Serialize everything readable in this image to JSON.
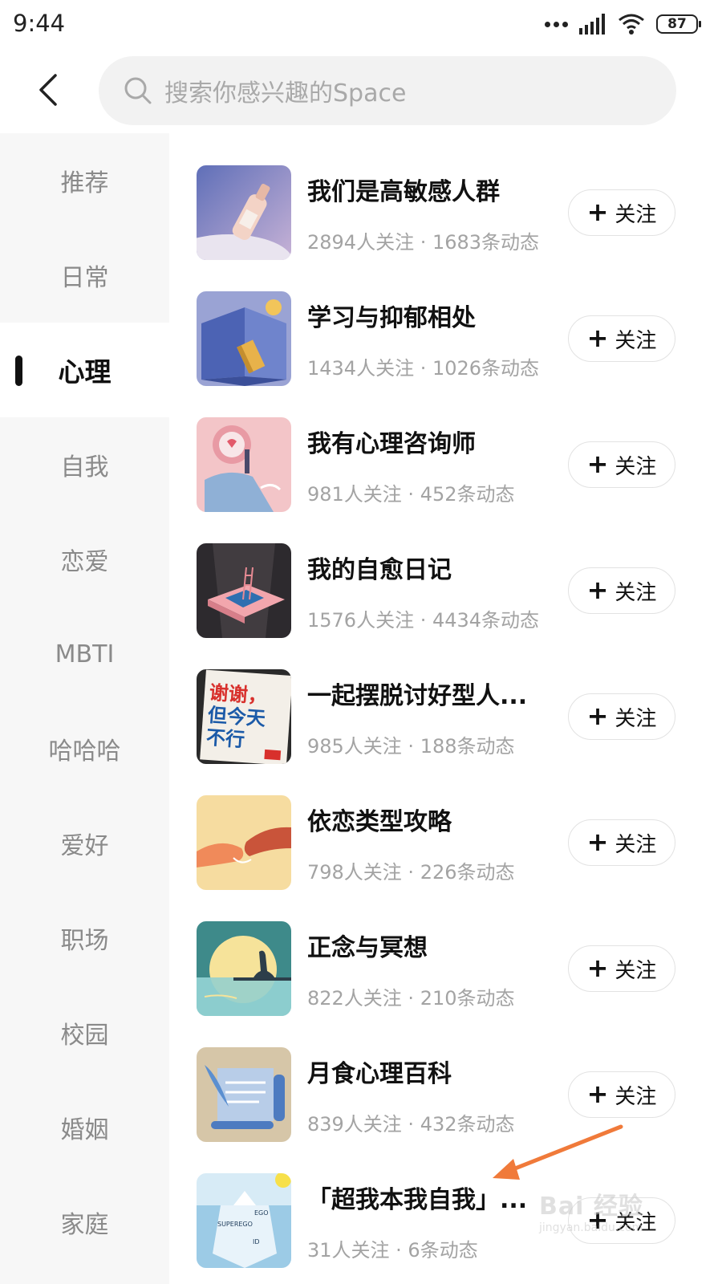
{
  "status_bar": {
    "time": "9:44",
    "battery": "87",
    "icons": [
      "dots-icon",
      "signal-icon",
      "wifi-icon",
      "battery-icon"
    ]
  },
  "header": {
    "back_icon": "chevron-left-icon",
    "search": {
      "icon": "search-icon",
      "placeholder": "搜索你感兴趣的Space"
    }
  },
  "sidebar": {
    "active_index": 2,
    "items": [
      {
        "label": "推荐"
      },
      {
        "label": "日常"
      },
      {
        "label": "心理"
      },
      {
        "label": "自我"
      },
      {
        "label": "恋爱"
      },
      {
        "label": "MBTI"
      },
      {
        "label": "哈哈哈"
      },
      {
        "label": "爱好"
      },
      {
        "label": "职场"
      },
      {
        "label": "校园"
      },
      {
        "label": "婚姻"
      },
      {
        "label": "家庭"
      }
    ]
  },
  "spaces": [
    {
      "title": "我们是高敏感人群",
      "stats": "2894人关注 · 1683条动态",
      "follow_label": "关注"
    },
    {
      "title": "学习与抑郁相处",
      "stats": "1434人关注 · 1026条动态",
      "follow_label": "关注"
    },
    {
      "title": "我有心理咨询师",
      "stats": "981人关注 · 452条动态",
      "follow_label": "关注"
    },
    {
      "title": "我的自愈日记",
      "stats": "1576人关注 · 4434条动态",
      "follow_label": "关注"
    },
    {
      "title": "一起摆脱讨好型人...",
      "stats": "985人关注 · 188条动态",
      "follow_label": "关注"
    },
    {
      "title": "依恋类型攻略",
      "stats": "798人关注 · 226条动态",
      "follow_label": "关注"
    },
    {
      "title": "正念与冥想",
      "stats": "822人关注 · 210条动态",
      "follow_label": "关注"
    },
    {
      "title": "月食心理百科",
      "stats": "839人关注 · 432条动态",
      "follow_label": "关注"
    },
    {
      "title": "「超我本我自我」...",
      "stats": "31人关注 · 6条动态",
      "follow_label": "关注"
    }
  ],
  "thumb_book_text": [
    "谢谢，",
    "但今天",
    "不行"
  ],
  "thumb_iceberg_text": [
    "SUPEREGO",
    "EGO",
    "ID"
  ],
  "watermark": {
    "logo": "Bai 经验",
    "site": "jingyan.baidu.com"
  },
  "colors": {
    "accent_arrow": "#f07a3a",
    "sidebar_bg": "#f7f7f7",
    "search_bg": "#f2f2f2"
  }
}
